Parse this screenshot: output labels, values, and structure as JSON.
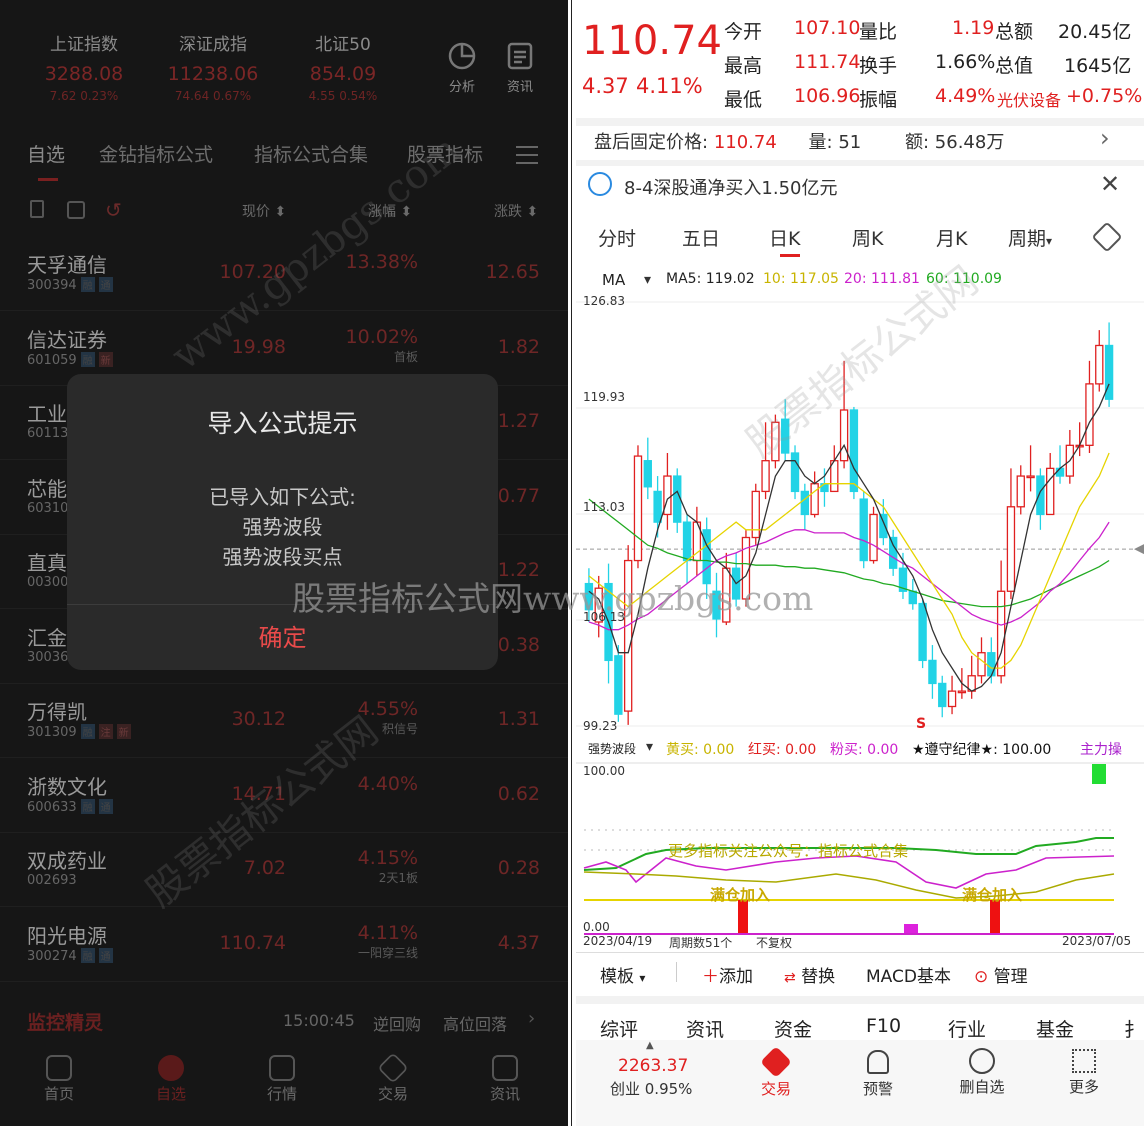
{
  "left": {
    "indices": [
      {
        "name": "上证指数",
        "value": "3288.08",
        "change": "7.62  0.23%"
      },
      {
        "name": "深证成指",
        "value": "11238.06",
        "change": "74.64  0.67%"
      },
      {
        "name": "北证50",
        "value": "854.09",
        "change": "4.55  0.54%"
      }
    ],
    "top_buttons": {
      "analysis": "分析",
      "news": "资讯"
    },
    "tabs": [
      "自选",
      "金钻指标公式",
      "指标公式合集",
      "股票指标"
    ],
    "columns": {
      "price": "现价 ⬍",
      "pct": "涨幅 ⬍",
      "chg": "涨跌 ⬍"
    },
    "stocks": [
      {
        "name": "天孚通信",
        "code": "300394",
        "tags": [
          "融",
          "通"
        ],
        "price": "107.20",
        "pct": "13.38%",
        "note": "",
        "chg": "12.65"
      },
      {
        "name": "信达证券",
        "code": "601059",
        "tags": [
          "融",
          "新"
        ],
        "price": "19.98",
        "pct": "10.02%",
        "note": "首板",
        "chg": "1.82"
      },
      {
        "name": "工业",
        "code": "60113",
        "tags": [],
        "price": "",
        "pct": "",
        "note": "",
        "chg": "1.27"
      },
      {
        "name": "芯能",
        "code": "60310",
        "tags": [],
        "price": "",
        "pct": "",
        "note": "",
        "chg": "0.77"
      },
      {
        "name": "直真",
        "code": "00300",
        "tags": [],
        "price": "",
        "pct": "",
        "note": "",
        "chg": "1.22"
      },
      {
        "name": "汇金",
        "code": "30036",
        "tags": [],
        "price": "",
        "pct": "",
        "note": "",
        "chg": "0.38"
      },
      {
        "name": "万得凯",
        "code": "301309",
        "tags": [
          "融",
          "注",
          "新"
        ],
        "price": "30.12",
        "pct": "4.55%",
        "note": "积信号",
        "chg": "1.31"
      },
      {
        "name": "浙数文化",
        "code": "600633",
        "tags": [
          "融",
          "通"
        ],
        "price": "14.71",
        "pct": "4.40%",
        "note": "",
        "chg": "0.62"
      },
      {
        "name": "双成药业",
        "code": "002693",
        "tags": [],
        "price": "7.02",
        "pct": "4.15%",
        "note": "2天1板",
        "chg": "0.28"
      },
      {
        "name": "阳光电源",
        "code": "300274",
        "tags": [
          "融",
          "通"
        ],
        "price": "110.74",
        "pct": "4.11%",
        "note": "一阳穿三线",
        "chg": "4.37"
      }
    ],
    "monitor": {
      "title": "监控精灵",
      "time": "15:00:45",
      "item1": "逆回购",
      "item2": "高位回落"
    },
    "nav": [
      "首页",
      "自选",
      "行情",
      "交易",
      "资讯"
    ],
    "dialog": {
      "title": "导入公式提示",
      "line1": "已导入如下公式:",
      "line2": "强势波段",
      "line3": "强势波段买点",
      "ok": "确定"
    }
  },
  "right": {
    "price": "110.74",
    "change": "4.37",
    "pct": "4.11%",
    "quotes": [
      [
        "今开",
        "107.10",
        "量比",
        "1.19",
        "总额",
        "20.45亿"
      ],
      [
        "最高",
        "111.74",
        "换手",
        "1.66%",
        "总值",
        "1645亿"
      ],
      [
        "最低",
        "106.96",
        "振幅",
        "4.49%",
        "光伏设备",
        "+0.75%"
      ]
    ],
    "after_hours": {
      "label": "盘后固定价格:",
      "price": "110.74",
      "vol_label": "量:",
      "vol": "51",
      "amt_label": "额:",
      "amt": "56.48万"
    },
    "news": "8-4深股通净买入1.50亿元",
    "periods": [
      "分时",
      "五日",
      "日K",
      "周K",
      "月K",
      "周期"
    ],
    "ma": {
      "label": "MA",
      "ma5": "MA5: 119.02",
      "ma10": "10: 117.05",
      "ma20": "20: 111.81",
      "ma60": "60: 110.09"
    },
    "y_ticks": [
      "126.83",
      "119.93",
      "113.03",
      "106.13",
      "99.23"
    ],
    "s_mark": "S",
    "indicator": {
      "name": "强势波段",
      "yellow": "黄买: 0.00",
      "red": "红买: 0.00",
      "pink": "粉买: 0.00",
      "star": "★遵守纪律★: 100.00",
      "main": "主力操"
    },
    "ind_ticks": {
      "top": "100.00",
      "bottom": "0.00"
    },
    "ind_text": {
      "more": "更多指标关注公众号：指标公式合集",
      "full1": "满仓加入",
      "full2": "满仓加入"
    },
    "dates": {
      "start": "2023/04/19",
      "count": "周期数51个",
      "adj": "不复权",
      "end": "2023/07/05"
    },
    "toolbar": {
      "template": "模板",
      "add": "添加",
      "replace": "替换",
      "macd": "MACD基本",
      "manage": "管理"
    },
    "bottom_tabs": [
      "综评",
      "资讯",
      "资金",
      "F10",
      "行业",
      "基金",
      "扌"
    ],
    "bottom_nav": {
      "index_value": "2263.37",
      "index_name": "创业 0.95%",
      "trade": "交易",
      "alert": "预警",
      "remove": "删自选",
      "more": "更多"
    },
    "colors": {
      "up": "#e02020",
      "down": "#22d3e6",
      "ma5": "#333333",
      "ma10": "#e6d400",
      "ma20": "#cc22cc",
      "ma60": "#22aa22"
    }
  },
  "watermarks": {
    "center": "股票指标公式网www.gpzbgs.com",
    "diag1": "www.gpzbgs.com",
    "diag2": "股票指标公式网",
    "diag3": "股票指标公式网"
  },
  "chart_data": {
    "type": "candlestick",
    "ylim": [
      99.23,
      126.83
    ],
    "x_range": [
      "2023/04/19",
      "2023/07/05"
    ],
    "candles": [
      [
        108.5,
        106.8,
        109.5,
        106.0
      ],
      [
        106.0,
        108.2,
        109.0,
        105.0
      ],
      [
        108.5,
        103.5,
        109.8,
        102.0
      ],
      [
        103.8,
        100.0,
        104.5,
        99.5
      ],
      [
        100.2,
        110.0,
        111.0,
        99.3
      ],
      [
        110.0,
        116.8,
        117.5,
        109.5
      ],
      [
        116.5,
        114.8,
        118.0,
        114.0
      ],
      [
        114.5,
        112.5,
        115.5,
        111.5
      ],
      [
        113.0,
        115.5,
        117.0,
        112.0
      ],
      [
        115.5,
        112.5,
        116.0,
        111.8
      ],
      [
        112.5,
        110.0,
        113.0,
        108.5
      ],
      [
        110.0,
        112.5,
        113.5,
        109.0
      ],
      [
        112.0,
        108.5,
        112.8,
        107.5
      ],
      [
        108.0,
        106.2,
        109.2,
        105.0
      ],
      [
        106.0,
        109.5,
        110.5,
        105.8
      ],
      [
        109.5,
        107.5,
        110.5,
        107.0
      ],
      [
        107.5,
        111.5,
        112.0,
        107.0
      ],
      [
        111.5,
        114.5,
        115.0,
        111.0
      ],
      [
        114.5,
        116.5,
        119.0,
        114.0
      ],
      [
        116.5,
        119.0,
        119.5,
        116.0
      ],
      [
        119.2,
        117.0,
        120.5,
        116.5
      ],
      [
        117.0,
        114.5,
        117.5,
        114.0
      ],
      [
        114.5,
        113.0,
        115.0,
        112.0
      ],
      [
        113.0,
        115.0,
        115.8,
        112.8
      ],
      [
        115.0,
        114.5,
        116.0,
        113.5
      ],
      [
        114.5,
        116.5,
        117.5,
        114.5
      ],
      [
        116.5,
        119.8,
        123.0,
        116.0
      ],
      [
        119.8,
        114.5,
        120.0,
        114.0
      ],
      [
        114.0,
        110.0,
        114.5,
        109.5
      ],
      [
        110.0,
        113.0,
        113.5,
        109.8
      ],
      [
        113.0,
        111.5,
        114.0,
        111.0
      ],
      [
        111.5,
        109.5,
        112.0,
        109.0
      ],
      [
        109.5,
        108.0,
        110.5,
        107.5
      ],
      [
        108.0,
        107.2,
        108.8,
        106.8
      ],
      [
        107.2,
        103.5,
        107.5,
        103.0
      ],
      [
        103.5,
        102.0,
        104.5,
        101.0
      ],
      [
        102.0,
        100.5,
        102.5,
        99.8
      ],
      [
        100.5,
        101.5,
        102.5,
        100.0
      ],
      [
        101.5,
        101.5,
        103.0,
        101.0
      ],
      [
        101.5,
        102.5,
        103.8,
        101.0
      ],
      [
        102.5,
        104.0,
        105.0,
        102.0
      ],
      [
        104.0,
        102.5,
        105.0,
        102.0
      ],
      [
        102.5,
        108.0,
        110.0,
        102.0
      ],
      [
        108.0,
        113.5,
        116.0,
        107.5
      ],
      [
        113.5,
        115.5,
        116.2,
        113.0
      ],
      [
        115.5,
        115.5,
        117.5,
        114.5
      ],
      [
        115.5,
        113.0,
        116.0,
        112.0
      ],
      [
        113.0,
        116.0,
        117.0,
        113.0
      ],
      [
        116.0,
        115.5,
        117.5,
        115.0
      ],
      [
        115.5,
        117.5,
        118.5,
        115.0
      ],
      [
        117.5,
        117.5,
        119.0,
        116.8
      ],
      [
        117.5,
        121.5,
        123.0,
        117.0
      ],
      [
        121.5,
        124.0,
        125.0,
        121.0
      ],
      [
        124.0,
        120.5,
        125.5,
        120.0
      ]
    ],
    "ma5": [
      108,
      107.5,
      106,
      104,
      104,
      106.5,
      109.5,
      112,
      114,
      114.5,
      113,
      112.5,
      111,
      110,
      109.5,
      108.5,
      109,
      110.5,
      113,
      115.5,
      116.5,
      116.5,
      115.5,
      115,
      115.5,
      116.5,
      117.5,
      116,
      115,
      114,
      112.5,
      111,
      110,
      109,
      107.5,
      105.5,
      104,
      103,
      102,
      101.5,
      101.8,
      102.5,
      104,
      107,
      110,
      113,
      114.5,
      115.3,
      116,
      116.5,
      117.5,
      119,
      120,
      121.5
    ],
    "ma10": [
      109,
      108.5,
      108,
      107.5,
      107,
      107.5,
      108,
      108.5,
      109,
      109.5,
      110,
      110.5,
      111,
      111.5,
      112,
      112.5,
      112,
      112,
      112,
      112.5,
      113,
      113.5,
      114,
      114.5,
      115,
      115,
      115,
      115,
      114.5,
      114,
      113.5,
      112.5,
      111.5,
      110.5,
      109.5,
      108.5,
      107.5,
      106.5,
      105,
      104,
      103.5,
      103,
      103,
      103.5,
      104.5,
      106,
      107.5,
      109,
      110.5,
      112,
      113.5,
      114.5,
      115.5,
      117
    ],
    "ma20": [
      106,
      105.8,
      105.5,
      105.5,
      105.8,
      106.2,
      106.5,
      107,
      107.5,
      108,
      108.5,
      109,
      109.5,
      110,
      110.3,
      110.5,
      110.8,
      111,
      111.2,
      111.5,
      111.8,
      112,
      112,
      111.8,
      111.8,
      111.8,
      111.8,
      111.5,
      111.3,
      111,
      110.6,
      110.2,
      109.8,
      109.5,
      109,
      108.5,
      108,
      107.5,
      107,
      106.5,
      106.2,
      106,
      105.8,
      106,
      106.3,
      106.8,
      107.3,
      108,
      108.5,
      109.2,
      110,
      110.8,
      111.5,
      112.5
    ],
    "ma60": [
      114,
      113.5,
      113,
      112.5,
      112,
      111.5,
      111,
      110.8,
      110.5,
      110.3,
      110.1,
      110,
      110,
      109.9,
      109.9,
      109.8,
      109.8,
      109.7,
      109.7,
      109.7,
      109.6,
      109.6,
      109.5,
      109.5,
      109.4,
      109.3,
      109.2,
      109,
      108.8,
      108.7,
      108.5,
      108.4,
      108.2,
      108,
      107.8,
      107.6,
      107.4,
      107.3,
      107.2,
      107.1,
      107,
      107,
      107,
      107.1,
      107.3,
      107.5,
      107.8,
      108.1,
      108.4,
      108.7,
      109,
      109.3,
      109.6,
      110
    ]
  }
}
